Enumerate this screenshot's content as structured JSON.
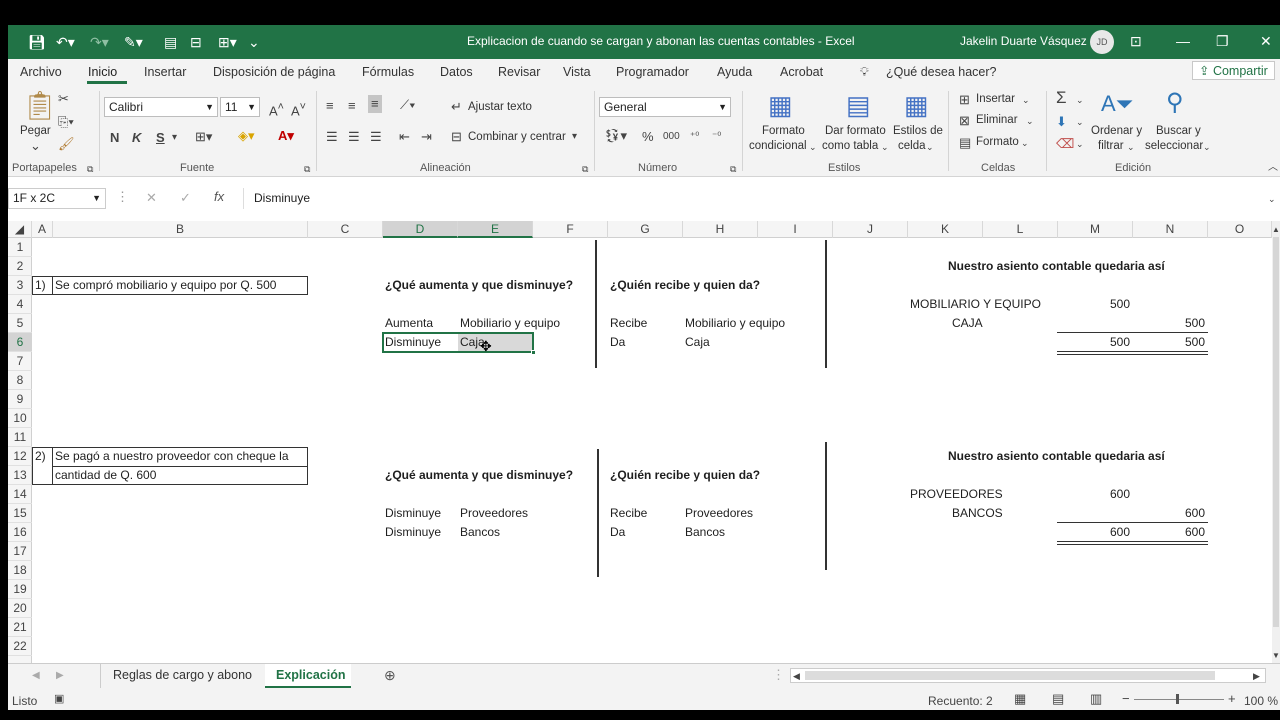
{
  "window": {
    "title": "Explicacion de cuando se cargan y abonan las cuentas contables  -  Excel",
    "user": "Jakelin Duarte Vásquez",
    "initials": "JD"
  },
  "tabs": [
    "Archivo",
    "Inicio",
    "Insertar",
    "Disposición de página",
    "Fórmulas",
    "Datos",
    "Revisar",
    "Vista",
    "Programador",
    "Ayuda",
    "Acrobat"
  ],
  "tell_me": "¿Qué desea hacer?",
  "share": "Compartir",
  "ribbon": {
    "paste": "Pegar",
    "font_name": "Calibri",
    "font_size": "11",
    "bold": "N",
    "italic": "K",
    "underline": "S",
    "wrap_text": "Ajustar texto",
    "merge_center": "Combinar y centrar",
    "number_format": "General",
    "cond_format": [
      "Formato",
      "condicional"
    ],
    "format_table": [
      "Dar formato",
      "como tabla"
    ],
    "cell_styles": [
      "Estilos de",
      "celda"
    ],
    "insert": "Insertar",
    "delete": "Eliminar",
    "format": "Formato",
    "sort_filter": [
      "Ordenar y",
      "filtrar"
    ],
    "find_select": [
      "Buscar y",
      "seleccionar"
    ],
    "groups": [
      "Portapapeles",
      "Fuente",
      "Alineación",
      "Número",
      "Estilos",
      "Celdas",
      "Edición"
    ]
  },
  "formula_bar": {
    "name_box": "1F x 2C",
    "content": "Disminuye"
  },
  "columns": [
    "A",
    "B",
    "C",
    "D",
    "E",
    "F",
    "G",
    "H",
    "I",
    "J",
    "K",
    "L",
    "M",
    "N",
    "O"
  ],
  "rows": [
    "1",
    "2",
    "3",
    "4",
    "5",
    "6",
    "7",
    "8",
    "9",
    "10",
    "11",
    "12",
    "13",
    "14",
    "15",
    "16",
    "17",
    "18",
    "19",
    "20",
    "21",
    "22"
  ],
  "cells": {
    "ex1_num": "1)",
    "ex1_text": "Se compró mobiliario y equipo por Q. 500",
    "ex1_q1": "¿Qué aumenta y que disminuye?",
    "ex1_a1l": "Aumenta",
    "ex1_a1v": "Mobiliario y equipo",
    "ex1_a2l": "Disminuye",
    "ex1_a2v": "Caja",
    "ex1_q2": "¿Quién recibe y quien da?",
    "ex1_b1l": "Recibe",
    "ex1_b1v": "Mobiliario y equipo",
    "ex1_b2l": "Da",
    "ex1_b2v": "Caja",
    "ex1_title": "Nuestro asiento contable quedaria así",
    "ex1_debit_acct": "MOBILIARIO Y EQUIPO",
    "ex1_debit_amt": "500",
    "ex1_credit_acct": "CAJA",
    "ex1_credit_amt": "500",
    "ex1_total_d": "500",
    "ex1_total_c": "500",
    "ex2_num": "2)",
    "ex2_text1": "Se pagó a nuestro proveedor con cheque la",
    "ex2_text2": "cantidad de Q. 600",
    "ex2_q1": "¿Qué aumenta y que disminuye?",
    "ex2_a1l": "Disminuye",
    "ex2_a1v": "Proveedores",
    "ex2_a2l": "Disminuye",
    "ex2_a2v": "Bancos",
    "ex2_q2": "¿Quién recibe y quien da?",
    "ex2_b1l": "Recibe",
    "ex2_b1v": "Proveedores",
    "ex2_b2l": "Da",
    "ex2_b2v": "Bancos",
    "ex2_title": "Nuestro asiento contable quedaria así",
    "ex2_debit_acct": "PROVEEDORES",
    "ex2_debit_amt": "600",
    "ex2_credit_acct": "BANCOS",
    "ex2_credit_amt": "600",
    "ex2_total_d": "600",
    "ex2_total_c": "600"
  },
  "sheets": [
    "Reglas de cargo y abono",
    "Explicación"
  ],
  "status": {
    "mode": "Listo",
    "count": "Recuento: 2",
    "zoom": "100 %"
  },
  "colors": {
    "excel_green": "#217346",
    "selection": "#217346"
  }
}
